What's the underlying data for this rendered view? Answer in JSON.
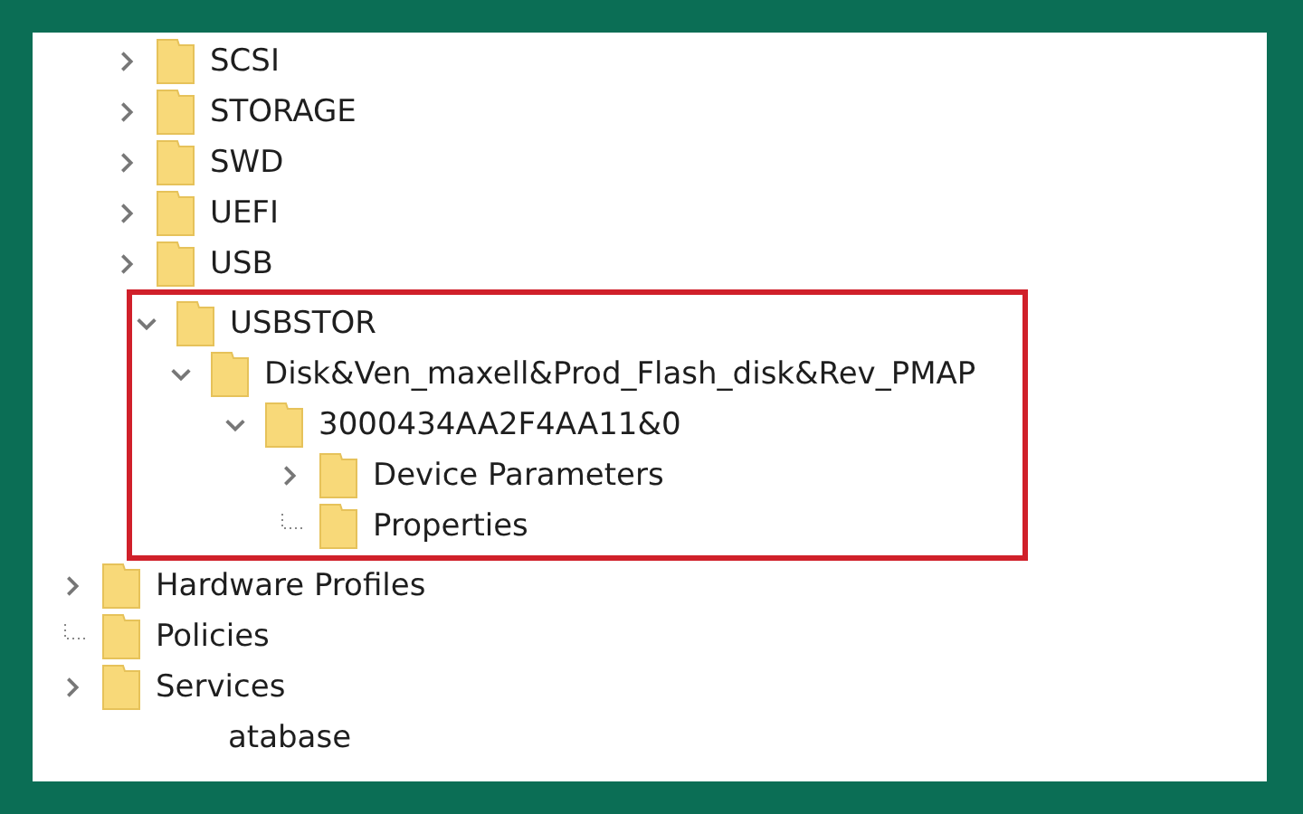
{
  "tree": [
    {
      "children": [
        {
          "label": "SCSI",
          "kind": "expandable",
          "expanded": false
        },
        {
          "label": "STORAGE",
          "kind": "expandable",
          "expanded": false
        },
        {
          "label": "SWD",
          "kind": "expandable",
          "expanded": false
        },
        {
          "label": "UEFI",
          "kind": "expandable",
          "expanded": false
        },
        {
          "label": "USB",
          "kind": "expandable",
          "expanded": false
        },
        {
          "label": "USBSTOR",
          "kind": "expandable",
          "expanded": true,
          "highlighted": true,
          "children": [
            {
              "label": "Disk&Ven_maxell&Prod_Flash_disk&Rev_PMAP",
              "kind": "expandable",
              "expanded": true,
              "children": [
                {
                  "label": "3000434AA2F4AA11&0",
                  "kind": "expandable",
                  "expanded": true,
                  "children": [
                    {
                      "label": "Device Parameters",
                      "kind": "expandable",
                      "expanded": false
                    },
                    {
                      "label": "Properties",
                      "kind": "leaf"
                    }
                  ]
                }
              ]
            }
          ]
        }
      ]
    },
    {
      "label": "Hardware Profiles",
      "kind": "expandable",
      "expanded": false
    },
    {
      "label": "Policies",
      "kind": "leaf"
    },
    {
      "label": "Services",
      "kind": "expandable",
      "expanded": false
    },
    {
      "children": [
        {
          "label": "atabase",
          "kind": "partial"
        }
      ]
    }
  ]
}
